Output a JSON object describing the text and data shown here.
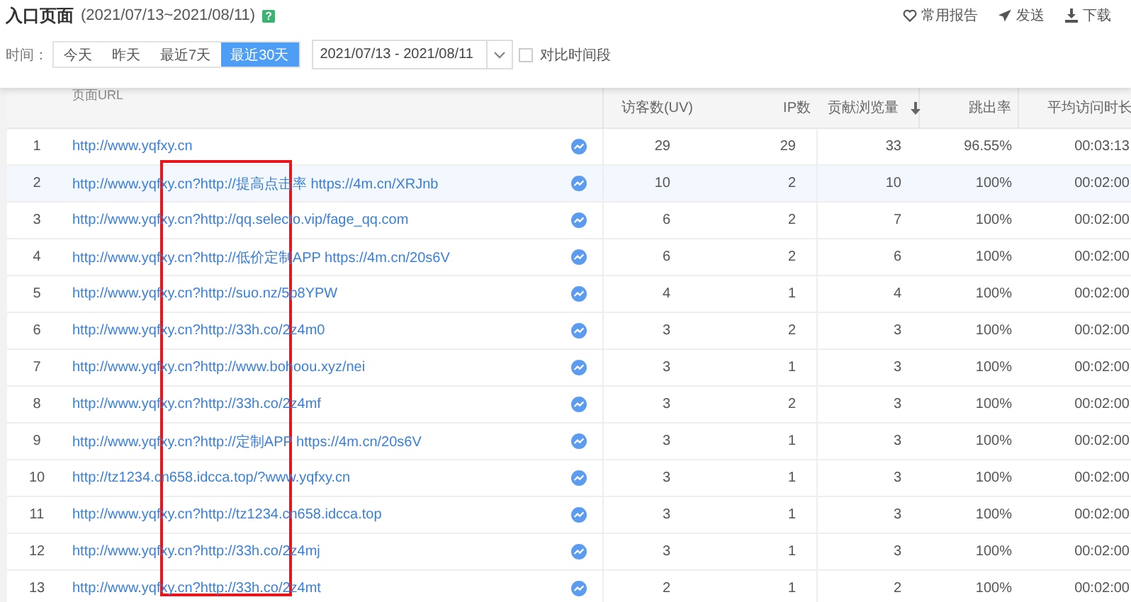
{
  "header": {
    "title": "入口页面",
    "range": "(2021/07/13~2021/08/11)",
    "help": "?",
    "actions": [
      {
        "kind": "heart",
        "label": "常用报告"
      },
      {
        "kind": "send",
        "label": "发送"
      },
      {
        "kind": "download",
        "label": "下载"
      }
    ]
  },
  "filter": {
    "label": "时间：",
    "periods": [
      {
        "label": "今天",
        "selected": false
      },
      {
        "label": "昨天",
        "selected": false
      },
      {
        "label": "最近7天",
        "selected": false
      },
      {
        "label": "最近30天",
        "selected": true
      }
    ],
    "date_range": "2021/07/13 - 2021/08/11",
    "compare": {
      "label": "对比时间段",
      "checked": false
    }
  },
  "table": {
    "columns": [
      {
        "label": "页面URL",
        "sorted": false
      },
      {
        "label": "访客数(UV)",
        "sorted": false
      },
      {
        "label": "IP数",
        "sorted": false
      },
      {
        "label": "贡献浏览量",
        "sorted": true
      },
      {
        "label": "跳出率",
        "sorted": false
      },
      {
        "label": "平均访问时长",
        "sorted": false
      }
    ],
    "rows": [
      {
        "index": "1",
        "url": "http://www.yqfxy.cn",
        "uv": "29",
        "ip": "29",
        "views": "33",
        "bounce": "96.55%",
        "avg": "00:03:13",
        "selected": false
      },
      {
        "index": "2",
        "url": "http://www.yqfxy.cn?http://提高点击率 https://4m.cn/XRJnb",
        "uv": "10",
        "ip": "2",
        "views": "10",
        "bounce": "100%",
        "avg": "00:02:00",
        "selected": true
      },
      {
        "index": "3",
        "url": "http://www.yqfxy.cn?http://qq.selecto.vip/fage_qq.com",
        "uv": "6",
        "ip": "2",
        "views": "7",
        "bounce": "100%",
        "avg": "00:02:00",
        "selected": false
      },
      {
        "index": "4",
        "url": "http://www.yqfxy.cn?http://低价定制APP https://4m.cn/20s6V",
        "uv": "6",
        "ip": "2",
        "views": "6",
        "bounce": "100%",
        "avg": "00:02:00",
        "selected": false
      },
      {
        "index": "5",
        "url": "http://www.yqfxy.cn?http://suo.nz/5p8YPW",
        "uv": "4",
        "ip": "1",
        "views": "4",
        "bounce": "100%",
        "avg": "00:02:00",
        "selected": false
      },
      {
        "index": "6",
        "url": "http://www.yqfxy.cn?http://33h.co/2z4m0",
        "uv": "3",
        "ip": "2",
        "views": "3",
        "bounce": "100%",
        "avg": "00:02:00",
        "selected": false
      },
      {
        "index": "7",
        "url": "http://www.yqfxy.cn?http://www.bohoou.xyz/nei",
        "uv": "3",
        "ip": "1",
        "views": "3",
        "bounce": "100%",
        "avg": "00:02:00",
        "selected": false
      },
      {
        "index": "8",
        "url": "http://www.yqfxy.cn?http://33h.co/2z4mf",
        "uv": "3",
        "ip": "2",
        "views": "3",
        "bounce": "100%",
        "avg": "00:02:00",
        "selected": false
      },
      {
        "index": "9",
        "url": "http://www.yqfxy.cn?http://定制APP https://4m.cn/20s6V",
        "uv": "3",
        "ip": "1",
        "views": "3",
        "bounce": "100%",
        "avg": "00:02:00",
        "selected": false
      },
      {
        "index": "10",
        "url": "http://tz1234.cn658.idcca.top/?www.yqfxy.cn",
        "uv": "3",
        "ip": "1",
        "views": "3",
        "bounce": "100%",
        "avg": "00:02:00",
        "selected": false
      },
      {
        "index": "11",
        "url": "http://www.yqfxy.cn?http://tz1234.cn658.idcca.top",
        "uv": "3",
        "ip": "1",
        "views": "3",
        "bounce": "100%",
        "avg": "00:02:00",
        "selected": false
      },
      {
        "index": "12",
        "url": "http://www.yqfxy.cn?http://33h.co/2z4mj",
        "uv": "3",
        "ip": "1",
        "views": "3",
        "bounce": "100%",
        "avg": "00:02:00",
        "selected": false
      },
      {
        "index": "13",
        "url": "http://www.yqfxy.cn?http://33h.co/2z4mt",
        "uv": "2",
        "ip": "1",
        "views": "2",
        "bounce": "100%",
        "avg": "00:02:00",
        "selected": false
      }
    ]
  }
}
